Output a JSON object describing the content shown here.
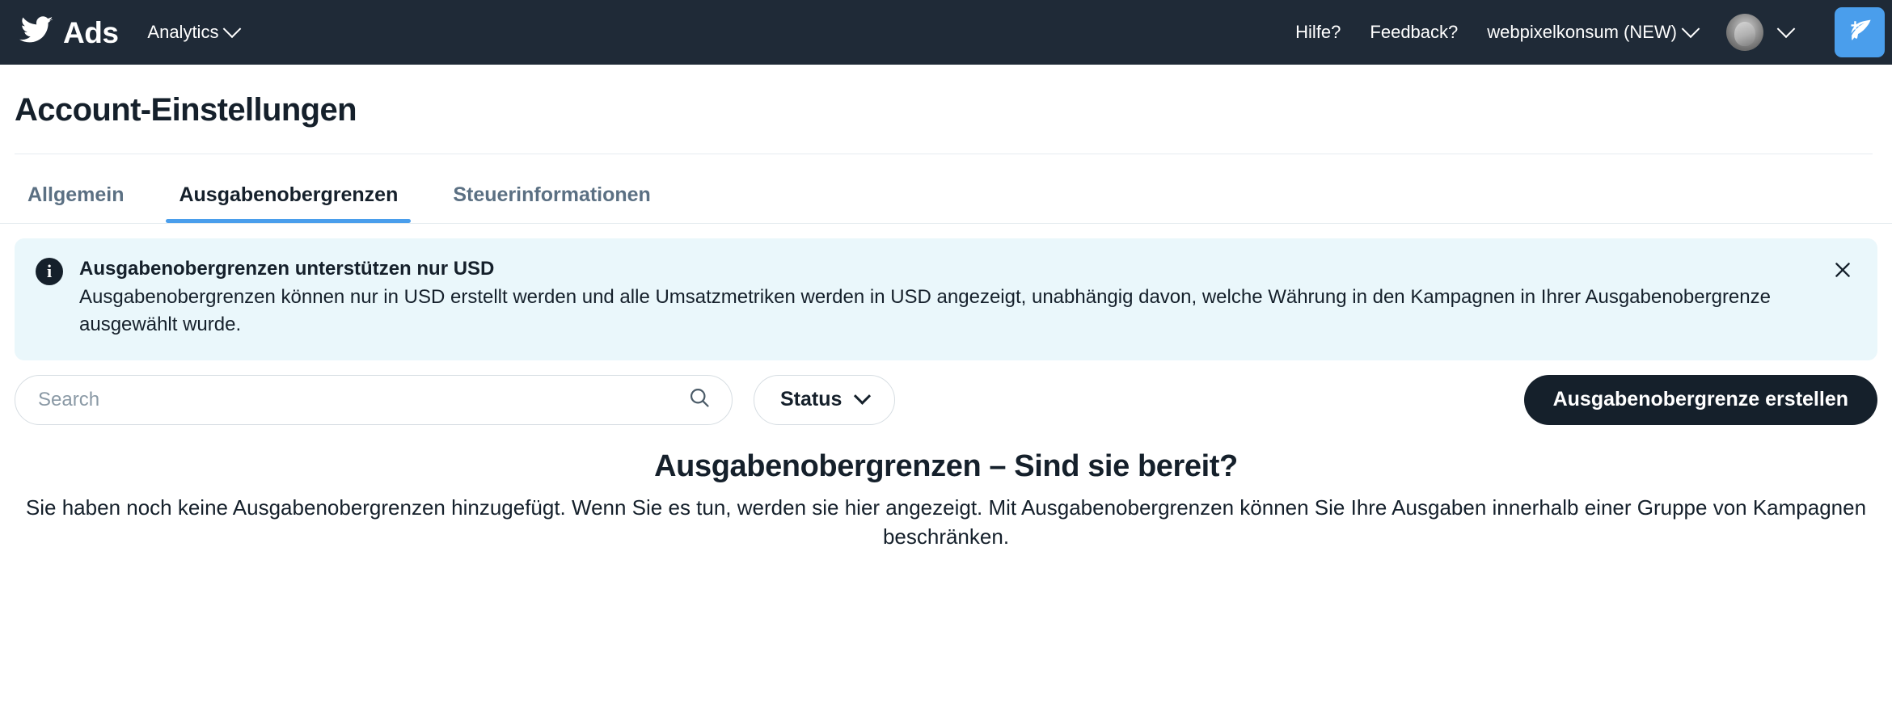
{
  "topnav": {
    "brand_label": "Ads",
    "brand_icon": "twitter-bird-icon",
    "analytics_label": "Analytics",
    "help_label": "Hilfe?",
    "feedback_label": "Feedback?",
    "account_label": "webpixelkonsum (NEW)",
    "compose_icon": "compose-tweet-icon",
    "background_color": "#1f2a37",
    "accent_color": "#4a9eec"
  },
  "page": {
    "title": "Account-Einstellungen"
  },
  "tabs": [
    {
      "label": "Allgemein",
      "active": false
    },
    {
      "label": "Ausgabenobergrenzen",
      "active": true
    },
    {
      "label": "Steuerinformationen",
      "active": false
    }
  ],
  "banner": {
    "icon": "info-icon",
    "title": "Ausgabenobergrenzen unterstützen nur USD",
    "body": "Ausgabenobergrenzen können nur in USD erstellt werden und alle Umsatzmetriken werden in USD angezeigt, unabhängig davon, welche Währung in den Kampagnen in Ihrer Ausgabenobergrenze ausgewählt wurde.",
    "close_icon": "close-icon",
    "background_color": "#eaf7fb"
  },
  "toolbar": {
    "search_placeholder": "Search",
    "search_value": "",
    "search_icon": "search-icon",
    "status_label": "Status",
    "status_chevron_icon": "chevron-down-icon",
    "create_label": "Ausgabenobergrenze erstellen"
  },
  "empty_state": {
    "title": "Ausgabenobergrenzen – Sind sie bereit?",
    "body": "Sie haben noch keine Ausgabenobergrenzen hinzugefügt. Wenn Sie es tun, werden sie hier angezeigt. Mit Ausgabenobergrenzen können Sie Ihre Ausgaben innerhalb einer Gruppe von Kampagnen beschränken."
  }
}
